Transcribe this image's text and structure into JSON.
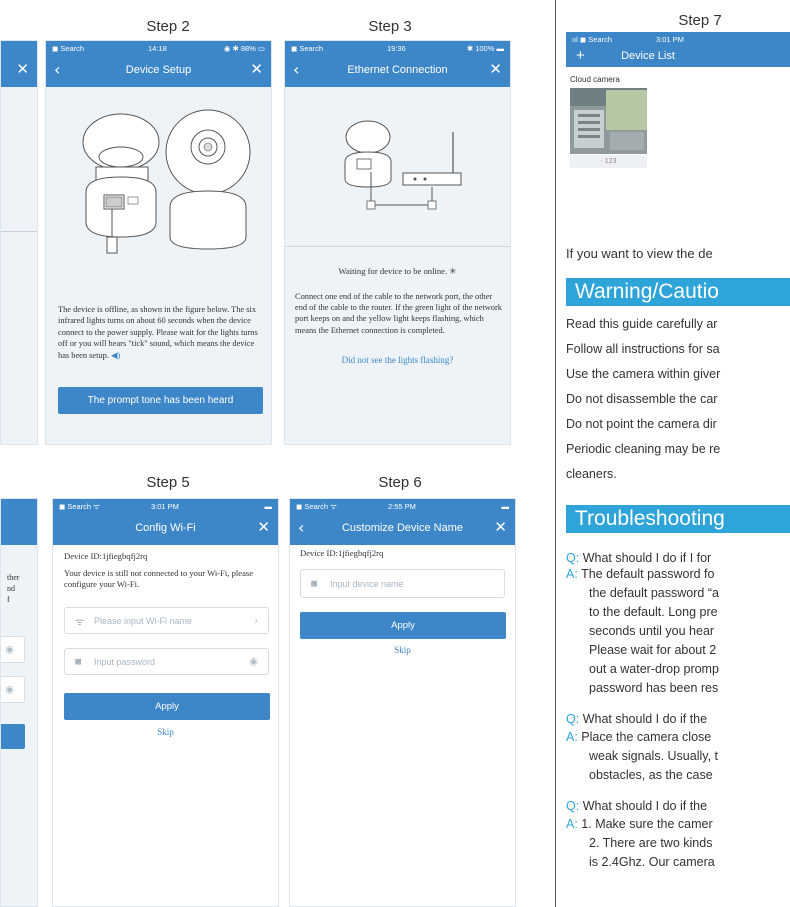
{
  "steps": {
    "step2": "Step 2",
    "step3": "Step 3",
    "step5": "Step 5",
    "step6": "Step 6",
    "step7": "Step 7"
  },
  "status": {
    "search": "Search",
    "s2_time": "14:18",
    "s2_battery": "88%",
    "s3_time": "19:36",
    "s3_battery": "100%",
    "s5_time": "3:01 PM",
    "s6_time": "2:55 PM",
    "s7_time": "3:01 PM"
  },
  "device_setup": {
    "title": "Device Setup",
    "desc": "The device is offline, as shown in the figure below. The six infrared lights turns on about 60 seconds when the device connect to the power supply. Please wait for the lights turns off or you will hears \"tick\" sound, which means the device has been setup.",
    "button": "The prompt tone has been heard"
  },
  "ethernet": {
    "title": "Ethernet Connection",
    "waiting": "Waiting for device to be online.",
    "desc": "Connect one end of the cable to the network port, the other end of the cable to the router. If the green light of the network port keeps on and the yellow light keeps flashing, which means the Ethernet connection is completed.",
    "link": "Did not see the lights flashing?"
  },
  "left_fragment": {
    "lines": [
      "ther",
      "nd",
      "f"
    ]
  },
  "config_wifi": {
    "title": "Config Wi-Fi",
    "device_id": "Device ID:1jfiegbqfj2rq",
    "desc": "Your device is still not connected to your Wi-Fi, please configure your Wi-Fi.",
    "wifi_placeholder": "Please input Wi-Fi name",
    "password_placeholder": "Input password",
    "apply": "Apply",
    "skip": "Skip"
  },
  "customize": {
    "title": "Customize Device Name",
    "device_id": "Device ID:1jfiegbqfj2rq",
    "name_placeholder": "Input device name",
    "apply": "Apply",
    "skip": "Skip"
  },
  "device_list": {
    "title": "Device List",
    "camera_name": "Cloud camera",
    "thumb_label": "123"
  },
  "right": {
    "view_line": "If you want to view the de",
    "warning_heading": "Warning/Cautio",
    "warnings": [
      "Read this guide carefully ar",
      "Follow all instructions for sa",
      "Use the camera within giver",
      "Do not disassemble the car",
      "Do not point the camera dir",
      "Periodic cleaning may be re",
      "cleaners."
    ],
    "troubleshooting_heading": "Troubleshooting",
    "faq": [
      {
        "prefix": "Q:",
        "lines": [
          "What should I do if I for"
        ]
      },
      {
        "prefix": "A:",
        "lines": [
          "The default password fo",
          "the default password “a",
          "to the default. Long pre",
          "seconds until you hear",
          "Please wait for about 2",
          "out a water-drop promp",
          "password has been res"
        ]
      },
      {
        "prefix": "Q:",
        "lines": [
          "What should I do if the"
        ]
      },
      {
        "prefix": "A:",
        "lines": [
          "Place the camera close",
          "weak signals. Usually, t",
          "obstacles, as the case"
        ]
      },
      {
        "prefix": "Q:",
        "lines": [
          "What should I do if the"
        ]
      },
      {
        "prefix": "A:",
        "lines": [
          "1. Make sure the camer",
          "2. There are two kinds",
          "is 2.4Ghz. Our camera"
        ]
      }
    ]
  }
}
